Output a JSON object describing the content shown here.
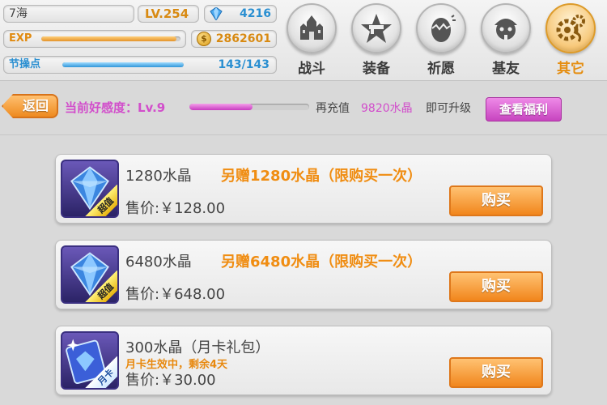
{
  "player": {
    "name": "7海",
    "level": "LV.254",
    "crystals": "4216",
    "exp_label": "EXP",
    "exp_progress": 0.97,
    "gold": "2862601",
    "stamina_label": "节操点",
    "stamina_value": "143/143",
    "stamina_progress": 1.0
  },
  "nav": [
    {
      "label": "战斗",
      "icon": "castle-icon"
    },
    {
      "label": "装备",
      "icon": "gun-star-icon"
    },
    {
      "label": "祈愿",
      "icon": "egg-icon"
    },
    {
      "label": "基友",
      "icon": "face-icon"
    },
    {
      "label": "其它",
      "icon": "gear-icon",
      "active": true
    }
  ],
  "favor": {
    "back_label": "返回",
    "level_text": "当前好感度：Lv.9",
    "progress": 0.53,
    "recharge_prefix": "再充值",
    "recharge_amount": "9820水晶",
    "recharge_suffix": "即可升级",
    "benefit_button": "查看福利"
  },
  "products": [
    {
      "name": "1280水晶",
      "bonus": "另赠1280水晶（限购买一次）",
      "status": "",
      "price": "售价:￥128.00",
      "tag": "超值",
      "buy_label": "购买"
    },
    {
      "name": "6480水晶",
      "bonus": "另赠6480水晶（限购买一次）",
      "status": "",
      "price": "售价:￥648.00",
      "tag": "超值",
      "buy_label": "购买"
    },
    {
      "name": "300水晶（月卡礼包）",
      "bonus": "",
      "status": "月卡生效中，剩余4天",
      "price": "售价:￥30.00",
      "tag": "月卡",
      "buy_label": "购买"
    }
  ],
  "colors": {
    "accent_orange": "#f08d12",
    "favor_pink": "#d24ecb",
    "stamina_blue": "#2a8fd1"
  }
}
